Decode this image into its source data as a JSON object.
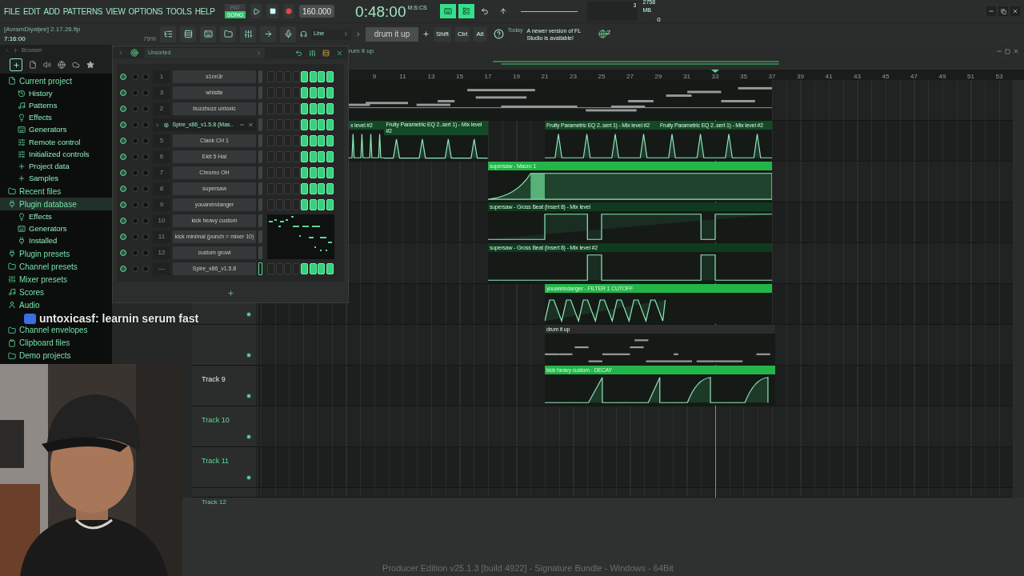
{
  "menu": [
    "FILE",
    "EDIT",
    "ADD",
    "PATTERNS",
    "VIEW",
    "OPTIONS",
    "TOOLS",
    "HELP"
  ],
  "transport": {
    "modes": [
      {
        "label": "PAT",
        "selected": false
      },
      {
        "label": "SONG",
        "selected": true
      }
    ],
    "tempo": "160.000",
    "time": "0:48:00",
    "time_unit": "M:S:CS"
  },
  "monitor": {
    "polyphony": "3",
    "memory": "2758 MB",
    "voices": "0"
  },
  "project": {
    "file": "[AvramDiyaljee] 2.17.26.flp",
    "duration": "7:16:00",
    "zoom": "79%"
  },
  "snap": "Line",
  "pattern": "drum it up",
  "keys": [
    "Shift",
    "Ctrl",
    "Alt"
  ],
  "news": {
    "label": "Today",
    "text": "A newer version of FL Studio is available!",
    "count": "2"
  },
  "browser": {
    "title": "Browser",
    "tree": [
      {
        "label": "Current project",
        "selected": false,
        "children": [
          {
            "label": "History",
            "selected": false
          },
          {
            "label": "Patterns",
            "selected": false
          },
          {
            "label": "Effects",
            "selected": false
          },
          {
            "label": "Generators",
            "selected": false
          },
          {
            "label": "Remote control",
            "selected": false
          },
          {
            "label": "Initialized controls",
            "selected": false
          },
          {
            "label": "Project data",
            "selected": false
          },
          {
            "label": "Samples",
            "selected": false
          }
        ]
      },
      {
        "label": "Recent files",
        "selected": false
      },
      {
        "label": "Plugin database",
        "selected": true,
        "children": [
          {
            "label": "Effects",
            "selected": false
          },
          {
            "label": "Generators",
            "selected": false
          },
          {
            "label": "Installed",
            "selected": false
          }
        ]
      },
      {
        "label": "Plugin presets",
        "selected": false
      },
      {
        "label": "Channel presets",
        "selected": false
      },
      {
        "label": "Mixer presets",
        "selected": false
      },
      {
        "label": "Scores",
        "selected": false
      },
      {
        "label": "Audio",
        "selected": false
      },
      {
        "label": "Channel envelopes",
        "selected": false
      },
      {
        "label": "Clipboard files",
        "selected": false
      },
      {
        "label": "Demo projects",
        "selected": false
      }
    ]
  },
  "channel_rack": {
    "filter": "Unsorted",
    "channels": [
      {
        "kind": "channel",
        "number": "1",
        "name": "s1nn3r",
        "selected": false,
        "steps": [
          false,
          false,
          false,
          false,
          true,
          true,
          true,
          true
        ]
      },
      {
        "kind": "channel",
        "number": "3",
        "name": "whistle",
        "selected": false,
        "steps": [
          false,
          false,
          false,
          false,
          true,
          true,
          true,
          true
        ]
      },
      {
        "kind": "channel",
        "number": "2",
        "name": "buzzbuzz untoxic",
        "selected": false,
        "steps": [
          false,
          false,
          false,
          false,
          true,
          true,
          true,
          true
        ]
      },
      {
        "kind": "wrapper",
        "name": "Spire_x86_v1.5.8 (Mas..",
        "selected": false,
        "steps": [
          false,
          false,
          false,
          false,
          true,
          true,
          true,
          true
        ]
      },
      {
        "kind": "channel",
        "number": "5",
        "name": "Clank CH 1",
        "selected": false,
        "steps": [
          false,
          false,
          false,
          false,
          true,
          true,
          true,
          true
        ]
      },
      {
        "kind": "channel",
        "number": "6",
        "name": "Ekit 5 Hat",
        "selected": false,
        "steps": [
          false,
          false,
          false,
          false,
          true,
          true,
          true,
          true
        ]
      },
      {
        "kind": "channel",
        "number": "7",
        "name": "Chromo OH",
        "selected": false,
        "steps": [
          false,
          false,
          false,
          false,
          true,
          true,
          true,
          true
        ]
      },
      {
        "kind": "channel",
        "number": "8",
        "name": "supersaw",
        "selected": false,
        "steps": [
          false,
          false,
          false,
          false,
          true,
          true,
          true,
          true
        ]
      },
      {
        "kind": "channel",
        "number": "9",
        "name": "youareindanger",
        "selected": false,
        "steps": [
          false,
          false,
          false,
          false,
          true,
          true,
          true,
          true
        ]
      },
      {
        "kind": "preview",
        "number": "10",
        "name": "kick heavy custom",
        "selected": false
      },
      {
        "kind": "preview",
        "number": "11",
        "name": "kick minimal (punch = mixer 10)",
        "selected": false
      },
      {
        "kind": "preview",
        "number": "12",
        "name": "custom growl",
        "selected": false
      },
      {
        "kind": "channel",
        "number": "—",
        "name": "Spire_x86_v1.5.8",
        "selected": true,
        "steps": [
          false,
          false,
          false,
          false,
          true,
          true,
          true,
          true
        ]
      }
    ]
  },
  "playlist": {
    "title": "rum it up",
    "ruler": [
      "9",
      "11",
      "13",
      "15",
      "17",
      "19",
      "21",
      "23",
      "25",
      "27",
      "29",
      "31",
      "33",
      "35",
      "37",
      "39",
      "41",
      "43",
      "45",
      "47",
      "49",
      "51",
      "53"
    ],
    "lanes": [
      {
        "clips": [
          {
            "kind": "notes"
          }
        ]
      },
      {
        "clips": [
          {
            "kind": "peaks",
            "label": "x level #2",
            "color": "#134a26"
          },
          {
            "kind": "peaks",
            "label": "Fruity Parametric EQ 2..sert 1) - Mix level #2",
            "color": "#134a26"
          },
          {
            "kind": "peaks",
            "label": "Fruity Parametric EQ 2..sert 1) - Mix level #2",
            "color": "#134a26"
          },
          {
            "kind": "peaks",
            "label": "Fruity Parametric EQ 2..sert 1) - Mix level #2",
            "color": "#134a26"
          }
        ]
      },
      {
        "clips": [
          {
            "kind": "ramp",
            "label": "supersaw - Macro 1",
            "color": "#22b548"
          }
        ]
      },
      {
        "clips": [
          {
            "kind": "gate",
            "label": "supersaw - Gross Beat (Insert 8) - Mix level",
            "color": "#0f3a1e"
          }
        ]
      },
      {
        "clips": [
          {
            "kind": "pulse",
            "label": "supersaw - Gross Beat (Insert 8) - Mix level #2",
            "color": "#0f3a1e"
          }
        ]
      },
      {
        "clips": [
          {
            "kind": "wave",
            "label": "youareindanger - FILTER 1 CUTOFF",
            "color": "#22b548"
          }
        ]
      },
      {
        "clips": [
          {
            "kind": "drum",
            "label": "drum it up",
            "color": "#2c2c2c"
          }
        ]
      },
      {
        "track": {
          "label": "Track 9",
          "selected": true
        },
        "clips": [
          {
            "kind": "decay",
            "label": "kick heavy custom - DECAY",
            "color": "#22b548"
          }
        ]
      },
      {
        "track": {
          "label": "Track 10",
          "selected": false
        }
      },
      {
        "track": {
          "label": "Track 11",
          "selected": false
        }
      },
      {
        "track": {
          "label": "Track 12",
          "selected": false
        }
      }
    ]
  },
  "chat": {
    "message": "untoxicasf:  learnin serum fast"
  },
  "status": "Producer Edition v25.1.3 [build 4922] - Signature Bundle - Windows - 64Bit"
}
